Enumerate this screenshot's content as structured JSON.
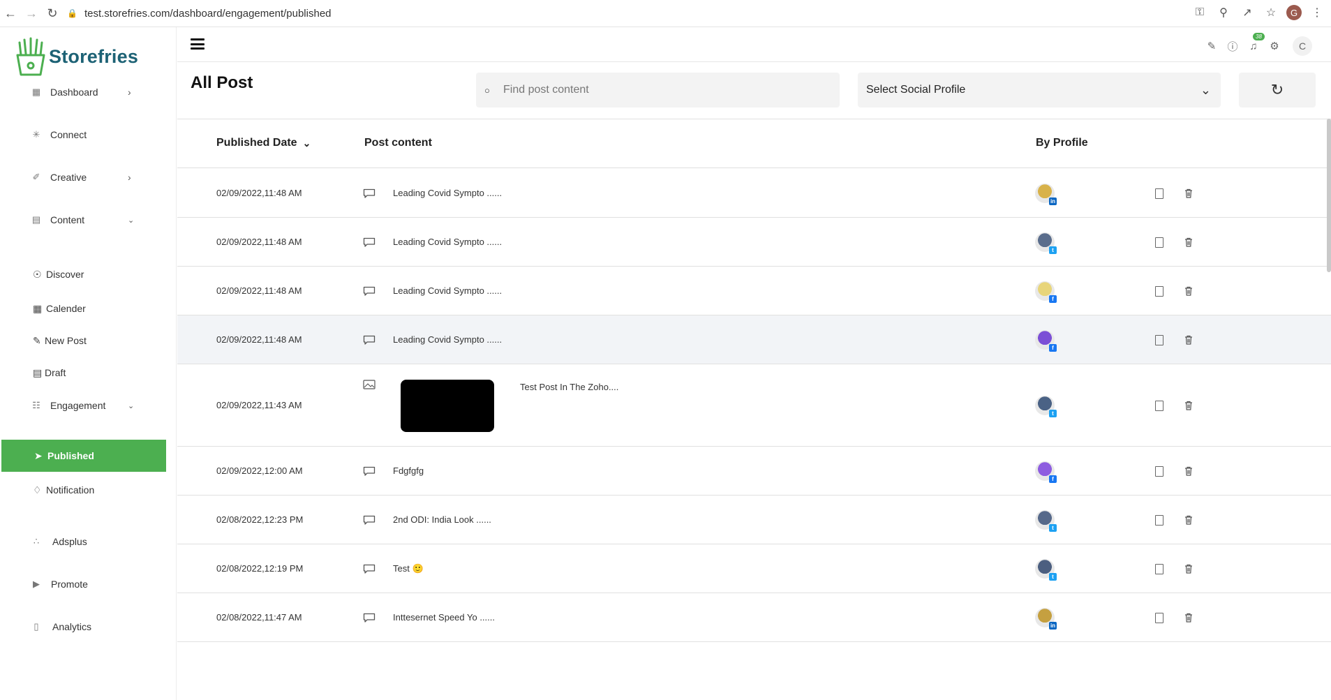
{
  "browser": {
    "url": "test.storefries.com/dashboard/engagement/published",
    "user_initial": "G"
  },
  "brand": {
    "name": "Storefries",
    "color": "#1d6275",
    "accent": "#4caf50"
  },
  "sidebar": {
    "items": [
      {
        "label": "Dashboard",
        "icon": "grid-icon",
        "expandable": true
      },
      {
        "label": "Connect",
        "icon": "connect-icon"
      },
      {
        "label": "Creative",
        "icon": "pen-icon",
        "expandable": true
      },
      {
        "label": "Content",
        "icon": "content-icon",
        "expanded": true
      },
      {
        "label": "Engagement",
        "icon": "engagement-icon",
        "expanded": true
      },
      {
        "label": "Adsplus",
        "icon": "adsplus-icon"
      },
      {
        "label": "Promote",
        "icon": "megaphone-icon"
      },
      {
        "label": "Analytics",
        "icon": "chart-icon"
      }
    ],
    "content_sub": [
      {
        "label": "Discover",
        "icon": "compass-icon"
      },
      {
        "label": "Calender",
        "icon": "calendar-icon"
      },
      {
        "label": "New Post",
        "icon": "edit-icon"
      },
      {
        "label": "Draft",
        "icon": "draft-icon"
      }
    ],
    "engagement_sub": [
      {
        "label": "Published",
        "icon": "send-icon",
        "active": true
      },
      {
        "label": "Notification",
        "icon": "tag-icon"
      }
    ]
  },
  "topbar": {
    "notification_count": "38",
    "user_initial": "C"
  },
  "page": {
    "title": "All Post",
    "search_placeholder": "Find post content",
    "social_select": "Select Social Profile"
  },
  "table": {
    "headers": {
      "date": "Published Date",
      "content": "Post content",
      "profile": "By Profile"
    },
    "rows": [
      {
        "date": "02/09/2022,11:48 AM",
        "type": "text",
        "content": "Leading Covid Sympto ......",
        "network": "linkedin"
      },
      {
        "date": "02/09/2022,11:48 AM",
        "type": "text",
        "content": "Leading Covid Sympto ......",
        "network": "twitter"
      },
      {
        "date": "02/09/2022,11:48 AM",
        "type": "text",
        "content": "Leading Covid Sympto ......",
        "network": "facebook"
      },
      {
        "date": "02/09/2022,11:48 AM",
        "type": "text",
        "content": "Leading Covid Sympto ......",
        "network": "facebook"
      },
      {
        "date": "02/09/2022,11:43 AM",
        "type": "image",
        "content": "Test Post In The Zoho....",
        "network": "twitter"
      },
      {
        "date": "02/09/2022,12:00 AM",
        "type": "text",
        "content": "Fdgfgfg",
        "network": "facebook"
      },
      {
        "date": "02/08/2022,12:23 PM",
        "type": "text",
        "content": "2nd ODI: India Look ......",
        "network": "twitter"
      },
      {
        "date": "02/08/2022,12:19 PM",
        "type": "text",
        "content": "Test 🙂",
        "network": "twitter"
      },
      {
        "date": "02/08/2022,11:47 AM",
        "type": "text",
        "content": "Inttesernet Speed Yo ......",
        "network": "linkedin"
      }
    ]
  }
}
